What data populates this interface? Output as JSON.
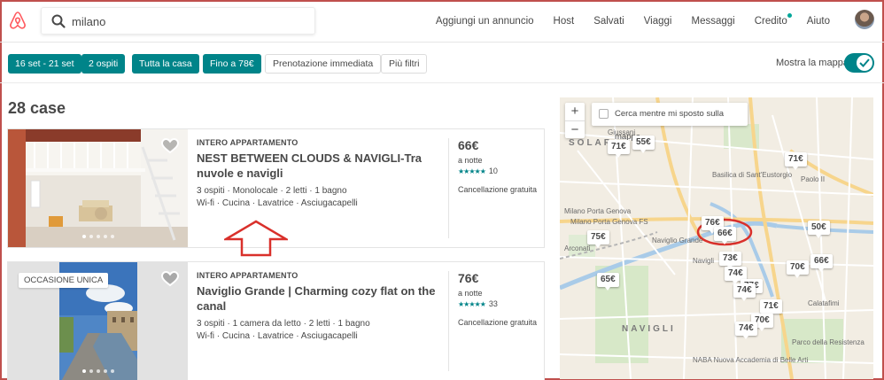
{
  "header": {
    "search_value": "milano",
    "nav": [
      "Aggiungi un annuncio",
      "Host",
      "Salvati",
      "Viaggi",
      "Messaggi",
      "Credito",
      "Aiuto"
    ]
  },
  "filters": {
    "dates": "16 set - 21 set",
    "guests": "2 ospiti",
    "type": "Tutta la casa",
    "price": "Fino a 78€",
    "instant": "Prenotazione immediata",
    "more": "Più filtri",
    "show_map": "Mostra la mappa"
  },
  "results": {
    "count": "28 case",
    "listings": [
      {
        "type": "INTERO APPARTAMENTO",
        "title": "NEST BETWEEN CLOUDS & NAVIGLI-Tra nuvole e navigli",
        "details": "3 ospiti · Monolocale · 2 letti · 1 bagno",
        "amenities": "Wi-fi · Cucina · Lavatrice · Asciugacapelli",
        "price": "66€",
        "per": "a notte",
        "stars": "★★★★★",
        "reviews": "10",
        "cancellation": "Cancellazione gratuita",
        "badge": ""
      },
      {
        "type": "INTERO APPARTAMENTO",
        "title": "Naviglio Grande | Charming cozy flat on the canal",
        "details": "3 ospiti · 1 camera da letto · 2 letti · 1 bagno",
        "amenities": "Wi-fi · Cucina · Lavatrice · Asciugacapelli",
        "price": "76€",
        "per": "a notte",
        "stars": "★★★★★",
        "reviews": "33",
        "cancellation": "Cancellazione gratuita",
        "badge": "OCCASIONE UNICA"
      }
    ]
  },
  "map": {
    "zoom_in": "+",
    "zoom_out": "−",
    "search_on_move": "Cerca mentre mi sposto sulla mappa",
    "places": [
      "SOLAR",
      "Giussani",
      "Basilica di Sant'Eustorgio",
      "Milano Porta Genova",
      "Milano Porta Genova FS",
      "Naviglio Grande",
      "Navigli",
      "Arconati",
      "NAVIGLI",
      "NABA Nuova Accademia di Belle Arti",
      "Parco della Resistenza",
      "Calatafimi",
      "Paolo II"
    ],
    "pins": [
      "71€",
      "55€",
      "71€",
      "76€",
      "66€",
      "50€",
      "75€",
      "73€",
      "70€",
      "66€",
      "74€",
      "65€",
      "77€",
      "74€",
      "71€",
      "70€",
      "74€"
    ]
  },
  "colors": {
    "accent": "#008489",
    "brand": "#ff5a5f",
    "annotation": "#d9302b"
  }
}
